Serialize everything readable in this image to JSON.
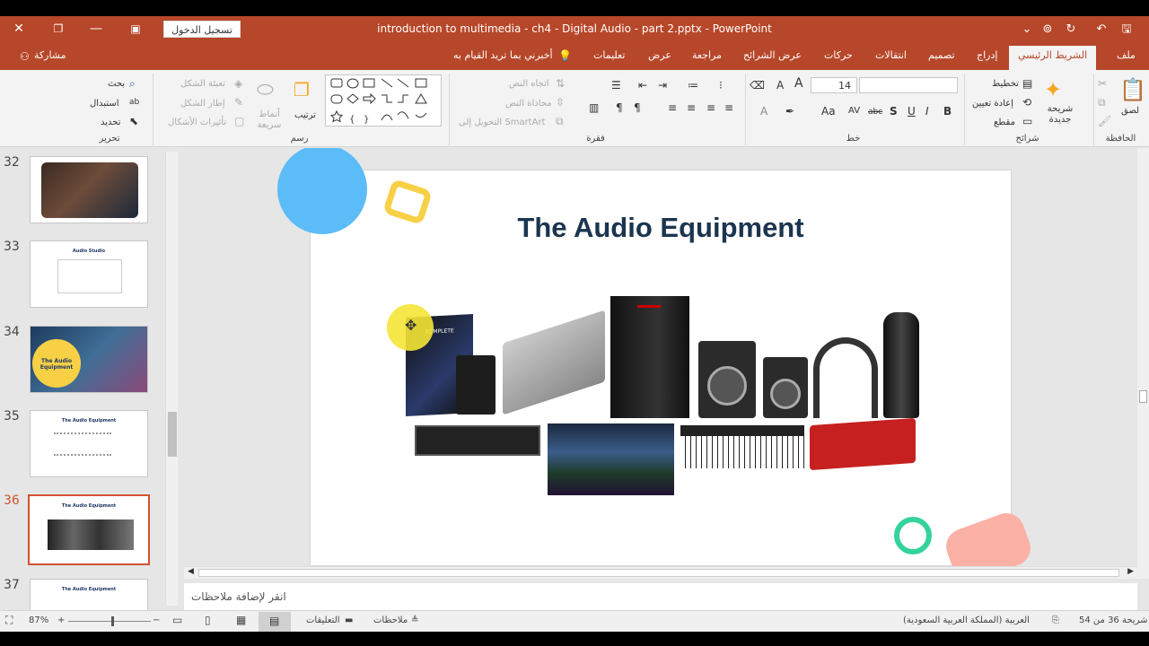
{
  "window": {
    "title": "introduction to multimedia - ch4 - Digital Audio - part 2.pptx  -  PowerPoint",
    "sign_in": "تسجيل الدخول",
    "close": "✕",
    "restore": "❐",
    "minimize": "—"
  },
  "tabs": [
    "ملف",
    "الشريط الرئيسي",
    "إدراج",
    "تصميم",
    "انتقالات",
    "حركات",
    "عرض الشرائح",
    "مراجعة",
    "عرض",
    "تعليمات",
    "أخبرني بما تريد القيام به"
  ],
  "share": "مشاركة",
  "ribbon": {
    "clipboard": {
      "label": "الحافظة",
      "paste": "لصق"
    },
    "slides": {
      "label": "شرائح",
      "new_slide": "شريحة جديدة",
      "layout": "تخطيط",
      "reset": "إعادة تعيين",
      "section": "مقطع"
    },
    "font": {
      "label": "خط",
      "size": "14",
      "bold": "B",
      "italic": "I",
      "underline": "U",
      "strike": "S",
      "spacing": "abc",
      "aa": "Aa",
      "grow": "A",
      "shrink": "A"
    },
    "paragraph": {
      "label": "فقرة",
      "text_direction": "اتجاه النص",
      "align_text": "محاذاة النص",
      "smartart": "التحويل إلى SmartArt"
    },
    "drawing": {
      "label": "رسم",
      "arrange": "ترتيب",
      "quick_styles": "أنماط سريعة",
      "fill": "تعبئة الشكل",
      "outline": "إطار الشكل",
      "effects": "تأثيرات الأشكال"
    },
    "editing": {
      "label": "تحرير",
      "find": "بحث",
      "replace": "استبدال",
      "select": "تحديد"
    }
  },
  "thumbnails": [
    {
      "num": "32",
      "title": ""
    },
    {
      "num": "33",
      "title": "Audio Studio"
    },
    {
      "num": "34",
      "title": "The Audio Equipment"
    },
    {
      "num": "35",
      "title": "The Audio Equipment"
    },
    {
      "num": "36",
      "title": "The Audio Equipment"
    },
    {
      "num": "37",
      "title": "The Audio Equipment"
    }
  ],
  "slide": {
    "title": "The Audio Equipment",
    "brand": "KOMPLETE"
  },
  "notes_placeholder": "انقر لإضافة ملاحظات",
  "status": {
    "slide_of": "شريحة 36 من 54",
    "language": "العربية (المملكة العربية السعودية)",
    "notes": "ملاحظات",
    "comments": "التعليقات",
    "zoom": "87%"
  },
  "colors": {
    "accent": "#b7472a",
    "slide_title": "#1b3550",
    "selected_thumb": "#d35230"
  }
}
